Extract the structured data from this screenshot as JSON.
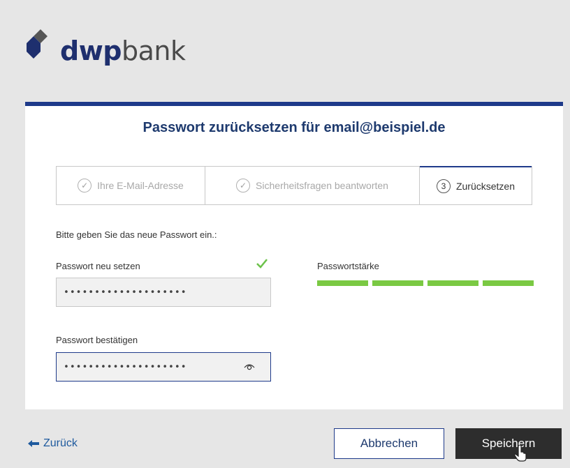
{
  "brand": {
    "bold": "dwp",
    "light": "bank"
  },
  "card": {
    "title": "Passwort zurücksetzen für email@beispiel.de"
  },
  "steps": [
    {
      "label": "Ihre E-Mail-Adresse",
      "marker": "✓",
      "state": "done"
    },
    {
      "label": "Sicherheitsfragen beantworten",
      "marker": "✓",
      "state": "done"
    },
    {
      "label": "Zurücksetzen",
      "marker": "3",
      "state": "active"
    }
  ],
  "form": {
    "intro": "Bitte geben Sie das neue Passwort ein.:",
    "new_password": {
      "label": "Passwort neu setzen",
      "value": "••••••••••••••••••••"
    },
    "confirm_password": {
      "label": "Passwort bestätigen",
      "value": "••••••••••••••••••••"
    },
    "strength": {
      "label": "Passwortstärke",
      "level": 4,
      "max": 4
    }
  },
  "nav": {
    "back_label": "Zurück",
    "cancel_label": "Abbrechen",
    "save_label": "Speichern"
  },
  "colors": {
    "accent": "#1e3a8a",
    "strength": "#7ac943",
    "save_bg": "#2d2d2d"
  }
}
